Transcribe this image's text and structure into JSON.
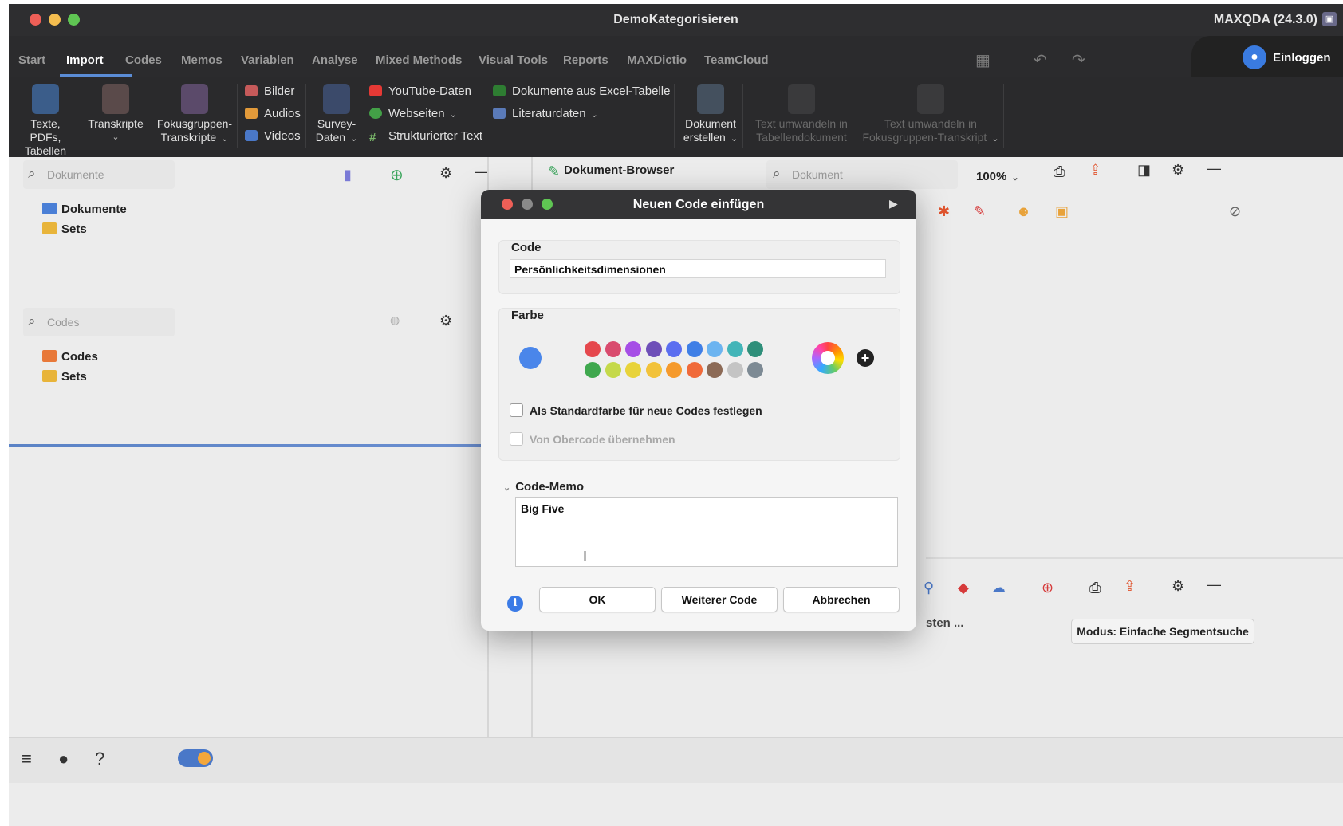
{
  "window": {
    "title": "DemoKategorisieren",
    "app_version": "MAXQDA (24.3.0)"
  },
  "menu": {
    "items": [
      "Start",
      "Import",
      "Codes",
      "Memos",
      "Variablen",
      "Analyse",
      "Mixed Methods",
      "Visual Tools",
      "Reports",
      "MAXDictio",
      "TeamCloud"
    ],
    "active": "Import",
    "login": "Einloggen"
  },
  "ribbon": {
    "texte": [
      "Texte, PDFs,",
      "Tabellen"
    ],
    "transkripte": "Transkripte",
    "fokus": [
      "Fokusgruppen-",
      "Transkripte"
    ],
    "bilder": "Bilder",
    "audios": "Audios",
    "videos": "Videos",
    "survey": [
      "Survey-",
      "Daten"
    ],
    "youtube": "YouTube-Daten",
    "webseiten": "Webseiten",
    "struktur": "Strukturierter Text",
    "excel": "Dokumente aus Excel-Tabelle",
    "literatur": "Literaturdaten",
    "dokument_erstellen": [
      "Dokument",
      "erstellen"
    ],
    "text_tabelle": [
      "Text umwandeln in",
      "Tabellendokument"
    ],
    "text_fokus": [
      "Text umwandeln in",
      "Fokusgruppen-Transkript"
    ]
  },
  "documents_pane": {
    "search_placeholder": "Dokumente",
    "items": [
      "Dokumente",
      "Sets"
    ]
  },
  "codes_pane": {
    "search_placeholder": "Codes",
    "items": [
      "Codes",
      "Sets"
    ]
  },
  "document_browser": {
    "title": "Dokument-Browser",
    "search_placeholder": "Dokument",
    "zoom": "100%",
    "result_partial": "sten ...",
    "mode": "Modus: Einfache Segmentsuche"
  },
  "dialog": {
    "title": "Neuen Code einfügen",
    "code_label": "Code",
    "code_value": "Persönlichkeitsdimensionen",
    "farbe_label": "Farbe",
    "selected_color": "#4a86ea",
    "palette_row1": [
      "#e5484d",
      "#d94b6e",
      "#a64ee6",
      "#6e4fb8",
      "#5b6ef0",
      "#3f7fe6",
      "#6cb4f0",
      "#43b5b8",
      "#2f8f7a"
    ],
    "palette_row2": [
      "#3fa84e",
      "#c5d94a",
      "#e8d33a",
      "#f2c23a",
      "#f59a2c",
      "#f06a3a",
      "#8c6a56",
      "#c4c4c4",
      "#7d8a94"
    ],
    "checkbox_default": "Als Standardfarbe für neue Codes festlegen",
    "checkbox_parent": "Von Obercode übernehmen",
    "memo_label": "Code-Memo",
    "memo_value": "Big Five",
    "ok": "OK",
    "weiter": "Weiterer Code",
    "abbrechen": "Abbrechen"
  }
}
